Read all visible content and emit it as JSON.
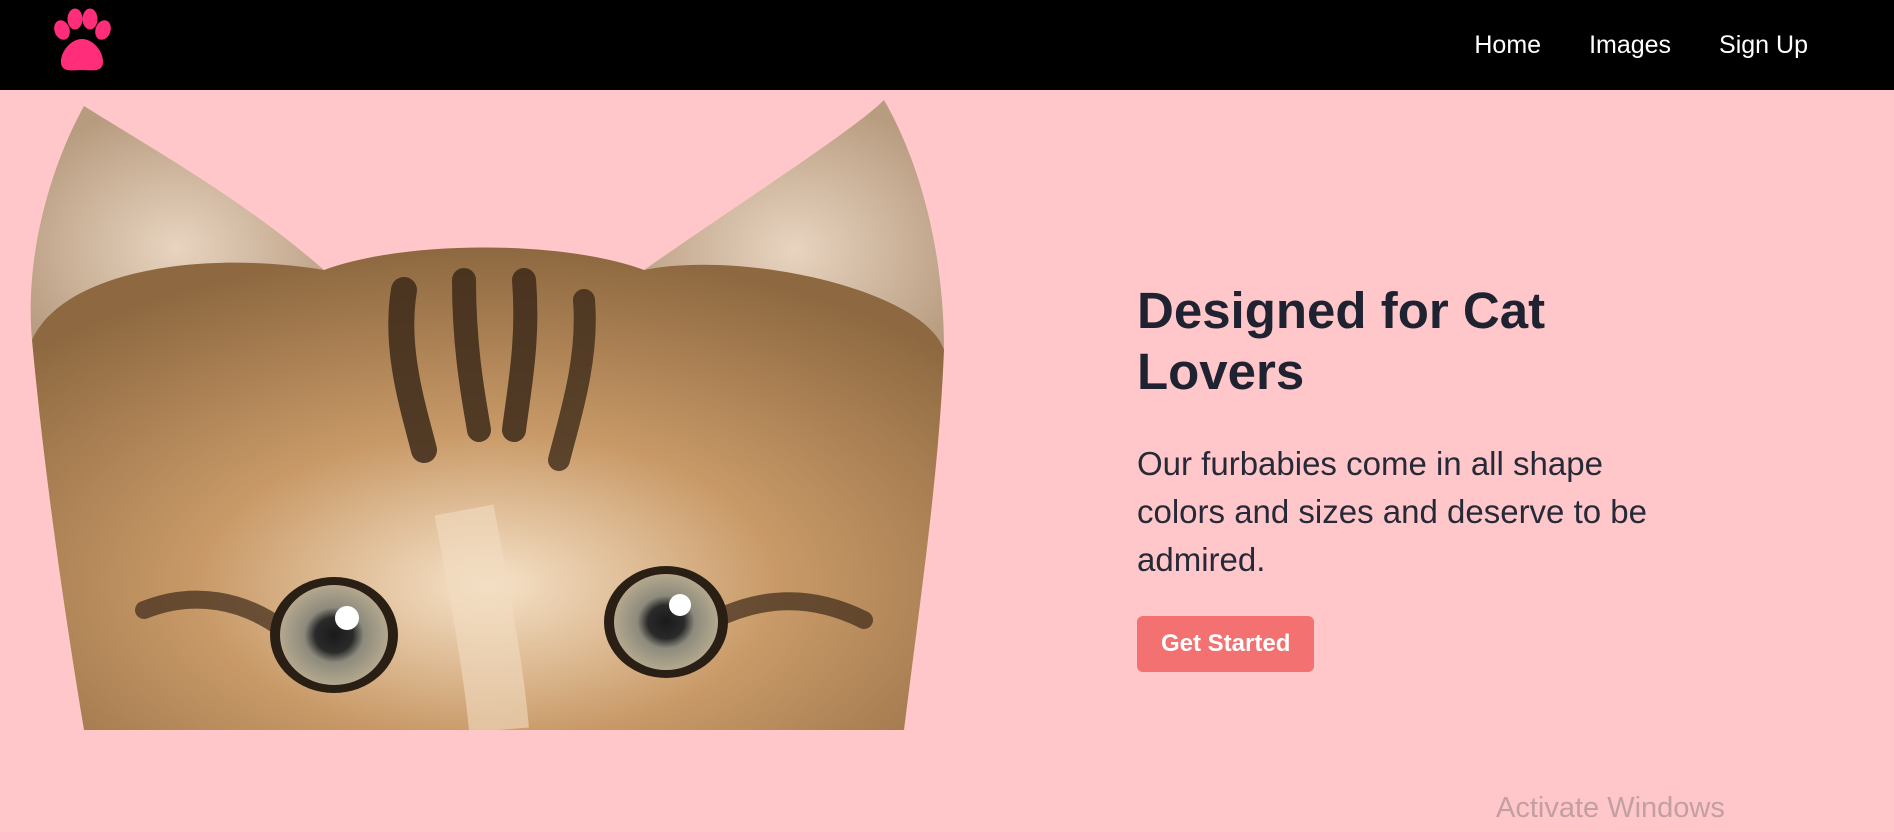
{
  "nav": {
    "logo_icon": "paw-icon",
    "logo_color": "#ff2d7a",
    "links": [
      {
        "label": "Home"
      },
      {
        "label": "Images"
      },
      {
        "label": "Sign Up"
      }
    ]
  },
  "hero": {
    "image_icon": "kitten-photo",
    "title": "Designed for Cat Lovers",
    "subtitle": "Our furbabies come in all shape colors and sizes and deserve to be admired.",
    "cta_label": "Get Started",
    "cta_color": "#f37171",
    "background_color": "#ffc7c9"
  },
  "system": {
    "watermark": "Activate Windows"
  }
}
